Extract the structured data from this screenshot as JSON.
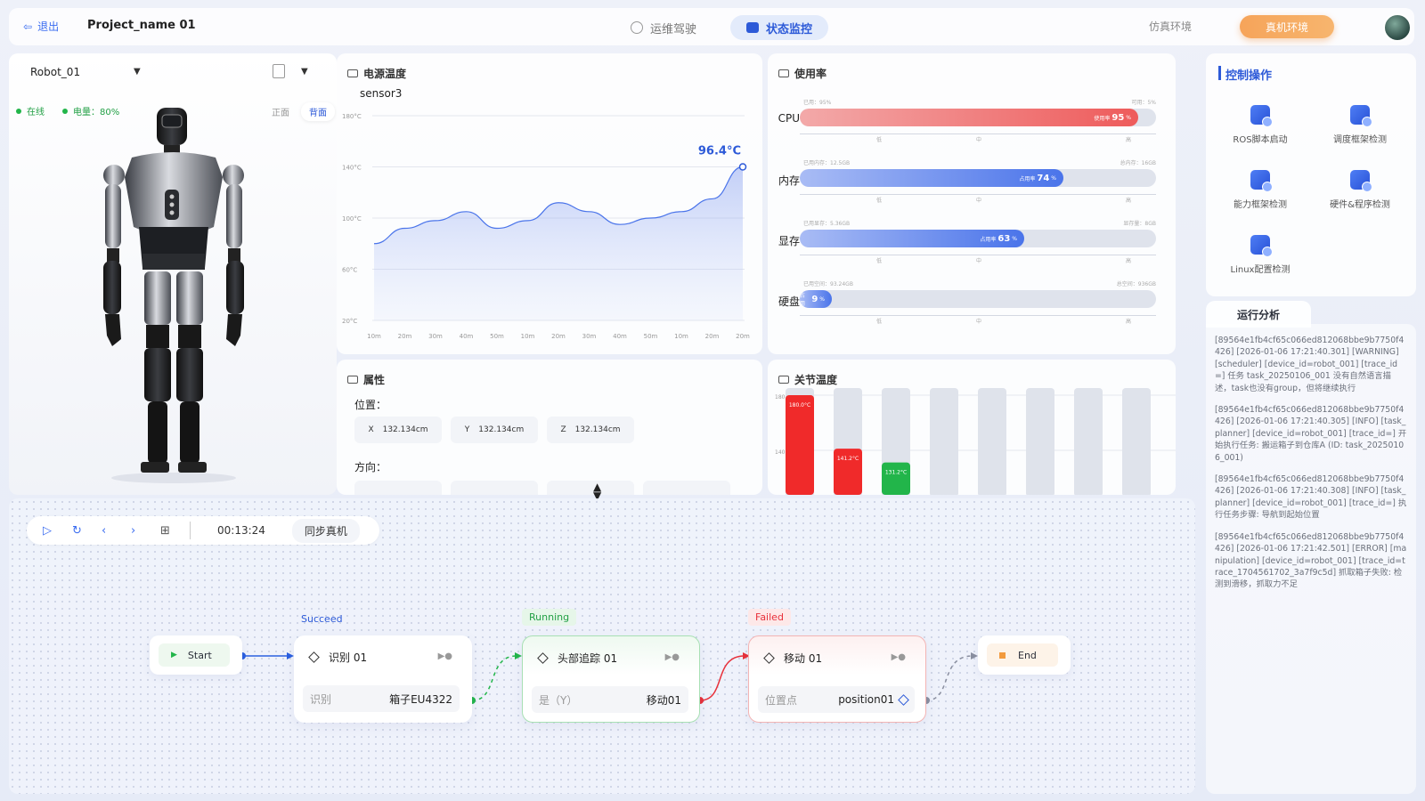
{
  "header": {
    "logout_label": "退出",
    "project_name": "Project_name 01",
    "tabs": [
      {
        "label": "运维驾驶",
        "active": false
      },
      {
        "label": "状态监控",
        "active": true
      }
    ],
    "env_sim": "仿真环境",
    "env_real": "真机环境"
  },
  "robot": {
    "name": "Robot_01",
    "status_online": "在线",
    "battery": "电量：80%",
    "view_front": "正面",
    "view_back": "背面"
  },
  "power_temp": {
    "title": "电源温度",
    "sensor": "sensor3",
    "current": "96.4°C"
  },
  "chart_data": {
    "type": "area",
    "title": "",
    "x": [
      "10m",
      "20m",
      "30m",
      "40m",
      "50m",
      "10m",
      "20m",
      "30m",
      "40m",
      "50m",
      "10m",
      "20m",
      "20m"
    ],
    "ytick_labels": [
      "20°C",
      "60°C",
      "100°C",
      "140°C",
      "180°C"
    ],
    "yticks": [
      20,
      60,
      100,
      140,
      180
    ],
    "ylim": [
      20,
      180
    ],
    "series": [
      {
        "name": "",
        "values": [
          80,
          92,
          98,
          105,
          92,
          98,
          112,
          105,
          95,
          100,
          105,
          115,
          140
        ]
      }
    ],
    "annotation": "96.4°C",
    "grid": true
  },
  "usage": {
    "title": "使用率",
    "rows": [
      {
        "label": "CPU",
        "used_text": "已用：95%",
        "avail_text": "可用：5%",
        "badge": "使用率",
        "percent": 95,
        "percent_text": "95",
        "color": "#ee5b5b"
      },
      {
        "label": "内存",
        "used_text": "已用内存：12.5GB",
        "avail_text": "总内存：16GB",
        "badge": "占用率",
        "percent": 74,
        "percent_text": "74",
        "color": "#4a74ea"
      },
      {
        "label": "显存",
        "used_text": "已用显存：5.36GB",
        "avail_text": "显存量：8GB",
        "badge": "占用率",
        "percent": 63,
        "percent_text": "63",
        "color": "#4a74ea"
      },
      {
        "label": "硬盘",
        "used_text": "已用空间：93.24GB",
        "avail_text": "总空间：936GB",
        "badge": "占用",
        "percent": 9,
        "percent_text": "9",
        "color": "#4a74ea"
      }
    ],
    "scale_labels": [
      "低",
      "中",
      "高"
    ]
  },
  "properties": {
    "title": "属性",
    "position_label": "位置：",
    "direction_label": "方向：",
    "position": [
      {
        "axis": "X",
        "value": "132.134cm"
      },
      {
        "axis": "Y",
        "value": "132.134cm"
      },
      {
        "axis": "Z",
        "value": "132.134cm"
      }
    ]
  },
  "joint_temp": {
    "title": "关节温度",
    "ytick_labels": [
      "180°C",
      "140°C"
    ],
    "bars": [
      {
        "value": 180.0,
        "label": "180.0°C",
        "color": "#f02a2a"
      },
      {
        "value": 141.2,
        "label": "141.2°C",
        "color": "#f02a2a"
      },
      {
        "value": 131.2,
        "label": "131.2°C",
        "color": "#22b54a"
      },
      {
        "value": null,
        "label": "",
        "color": ""
      },
      {
        "value": null,
        "label": "",
        "color": ""
      },
      {
        "value": null,
        "label": "",
        "color": ""
      },
      {
        "value": null,
        "label": "",
        "color": ""
      },
      {
        "value": null,
        "label": "",
        "color": ""
      }
    ]
  },
  "control": {
    "title": "控制操作",
    "items": [
      {
        "label": "ROS脚本启动",
        "icon": "ros-icon"
      },
      {
        "label": "调度框架检测",
        "icon": "schedule-icon"
      },
      {
        "label": "能力框架检测",
        "icon": "ability-icon"
      },
      {
        "label": "硬件&程序检测",
        "icon": "hardware-icon"
      },
      {
        "label": "Linux配置检测",
        "icon": "linux-icon"
      }
    ]
  },
  "analysis": {
    "title": "运行分析",
    "logs": [
      "[89564e1fb4cf65c066ed812068bbe9b7750f4426] [2026-01-06 17:21:40.301] [WARNING] [scheduler] [device_id=robot_001] [trace_id=] 任务 task_20250106_001 没有自然语言描述，task也没有group，但将继续执行",
      "[89564e1fb4cf65c066ed812068bbe9b7750f4426] [2026-01-06 17:21:40.305] [INFO] [task_planner] [device_id=robot_001] [trace_id=] 开始执行任务: 搬运箱子到仓库A (ID: task_20250106_001)",
      "[89564e1fb4cf65c066ed812068bbe9b7750f4426] [2026-01-06 17:21:40.308] [INFO] [task_planner] [device_id=robot_001] [trace_id=] 执行任务步骤: 导航到起始位置",
      "[89564e1fb4cf65c066ed812068bbe9b7750f4426] [2026-01-06 17:21:42.501] [ERROR] [manipulation] [device_id=robot_001] [trace_id=trace_1704561702_3a7f9c5d] 抓取箱子失败: 检测到滑移，抓取力不足"
    ]
  },
  "toolbar": {
    "time": "00:13:24",
    "sync_label": "同步真机"
  },
  "flow": {
    "start": "Start",
    "end": "End",
    "nodes": [
      {
        "status": "Succeed",
        "title": "识别 01",
        "field_key": "识别",
        "field_value": "箱子EU4322"
      },
      {
        "status": "Running",
        "title": "头部追踪 01",
        "field_key": "是（Y）",
        "field_value": "移动01"
      },
      {
        "status": "Failed",
        "title": "移动 01",
        "field_key": "位置点",
        "field_value": "position01"
      }
    ]
  }
}
